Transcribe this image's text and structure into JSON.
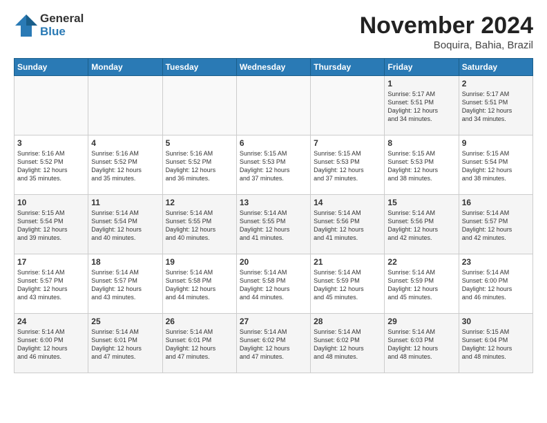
{
  "logo": {
    "general": "General",
    "blue": "Blue"
  },
  "header": {
    "month": "November 2024",
    "location": "Boquira, Bahia, Brazil"
  },
  "weekdays": [
    "Sunday",
    "Monday",
    "Tuesday",
    "Wednesday",
    "Thursday",
    "Friday",
    "Saturday"
  ],
  "weeks": [
    [
      {
        "day": "",
        "info": ""
      },
      {
        "day": "",
        "info": ""
      },
      {
        "day": "",
        "info": ""
      },
      {
        "day": "",
        "info": ""
      },
      {
        "day": "",
        "info": ""
      },
      {
        "day": "1",
        "info": "Sunrise: 5:17 AM\nSunset: 5:51 PM\nDaylight: 12 hours\nand 34 minutes."
      },
      {
        "day": "2",
        "info": "Sunrise: 5:17 AM\nSunset: 5:51 PM\nDaylight: 12 hours\nand 34 minutes."
      }
    ],
    [
      {
        "day": "3",
        "info": "Sunrise: 5:16 AM\nSunset: 5:52 PM\nDaylight: 12 hours\nand 35 minutes."
      },
      {
        "day": "4",
        "info": "Sunrise: 5:16 AM\nSunset: 5:52 PM\nDaylight: 12 hours\nand 35 minutes."
      },
      {
        "day": "5",
        "info": "Sunrise: 5:16 AM\nSunset: 5:52 PM\nDaylight: 12 hours\nand 36 minutes."
      },
      {
        "day": "6",
        "info": "Sunrise: 5:15 AM\nSunset: 5:53 PM\nDaylight: 12 hours\nand 37 minutes."
      },
      {
        "day": "7",
        "info": "Sunrise: 5:15 AM\nSunset: 5:53 PM\nDaylight: 12 hours\nand 37 minutes."
      },
      {
        "day": "8",
        "info": "Sunrise: 5:15 AM\nSunset: 5:53 PM\nDaylight: 12 hours\nand 38 minutes."
      },
      {
        "day": "9",
        "info": "Sunrise: 5:15 AM\nSunset: 5:54 PM\nDaylight: 12 hours\nand 38 minutes."
      }
    ],
    [
      {
        "day": "10",
        "info": "Sunrise: 5:15 AM\nSunset: 5:54 PM\nDaylight: 12 hours\nand 39 minutes."
      },
      {
        "day": "11",
        "info": "Sunrise: 5:14 AM\nSunset: 5:54 PM\nDaylight: 12 hours\nand 40 minutes."
      },
      {
        "day": "12",
        "info": "Sunrise: 5:14 AM\nSunset: 5:55 PM\nDaylight: 12 hours\nand 40 minutes."
      },
      {
        "day": "13",
        "info": "Sunrise: 5:14 AM\nSunset: 5:55 PM\nDaylight: 12 hours\nand 41 minutes."
      },
      {
        "day": "14",
        "info": "Sunrise: 5:14 AM\nSunset: 5:56 PM\nDaylight: 12 hours\nand 41 minutes."
      },
      {
        "day": "15",
        "info": "Sunrise: 5:14 AM\nSunset: 5:56 PM\nDaylight: 12 hours\nand 42 minutes."
      },
      {
        "day": "16",
        "info": "Sunrise: 5:14 AM\nSunset: 5:57 PM\nDaylight: 12 hours\nand 42 minutes."
      }
    ],
    [
      {
        "day": "17",
        "info": "Sunrise: 5:14 AM\nSunset: 5:57 PM\nDaylight: 12 hours\nand 43 minutes."
      },
      {
        "day": "18",
        "info": "Sunrise: 5:14 AM\nSunset: 5:57 PM\nDaylight: 12 hours\nand 43 minutes."
      },
      {
        "day": "19",
        "info": "Sunrise: 5:14 AM\nSunset: 5:58 PM\nDaylight: 12 hours\nand 44 minutes."
      },
      {
        "day": "20",
        "info": "Sunrise: 5:14 AM\nSunset: 5:58 PM\nDaylight: 12 hours\nand 44 minutes."
      },
      {
        "day": "21",
        "info": "Sunrise: 5:14 AM\nSunset: 5:59 PM\nDaylight: 12 hours\nand 45 minutes."
      },
      {
        "day": "22",
        "info": "Sunrise: 5:14 AM\nSunset: 5:59 PM\nDaylight: 12 hours\nand 45 minutes."
      },
      {
        "day": "23",
        "info": "Sunrise: 5:14 AM\nSunset: 6:00 PM\nDaylight: 12 hours\nand 46 minutes."
      }
    ],
    [
      {
        "day": "24",
        "info": "Sunrise: 5:14 AM\nSunset: 6:00 PM\nDaylight: 12 hours\nand 46 minutes."
      },
      {
        "day": "25",
        "info": "Sunrise: 5:14 AM\nSunset: 6:01 PM\nDaylight: 12 hours\nand 47 minutes."
      },
      {
        "day": "26",
        "info": "Sunrise: 5:14 AM\nSunset: 6:01 PM\nDaylight: 12 hours\nand 47 minutes."
      },
      {
        "day": "27",
        "info": "Sunrise: 5:14 AM\nSunset: 6:02 PM\nDaylight: 12 hours\nand 47 minutes."
      },
      {
        "day": "28",
        "info": "Sunrise: 5:14 AM\nSunset: 6:02 PM\nDaylight: 12 hours\nand 48 minutes."
      },
      {
        "day": "29",
        "info": "Sunrise: 5:14 AM\nSunset: 6:03 PM\nDaylight: 12 hours\nand 48 minutes."
      },
      {
        "day": "30",
        "info": "Sunrise: 5:15 AM\nSunset: 6:04 PM\nDaylight: 12 hours\nand 48 minutes."
      }
    ]
  ]
}
